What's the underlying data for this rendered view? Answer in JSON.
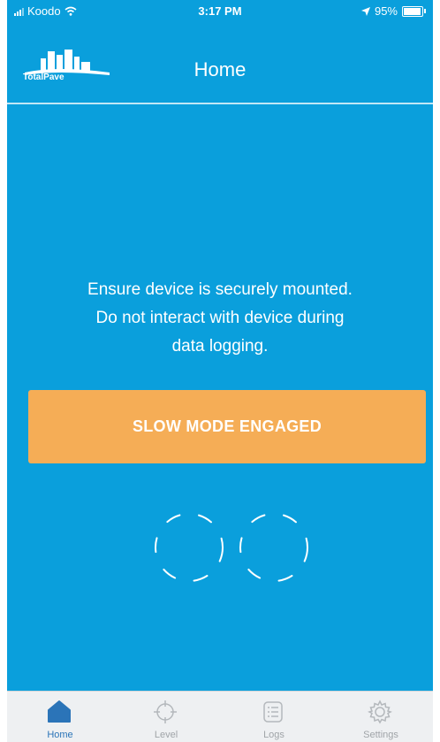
{
  "status_bar": {
    "carrier": "Koodo",
    "time": "3:17 PM",
    "battery": "95%",
    "battery_level": 0.95
  },
  "header": {
    "logo_text": "TotalPave",
    "title": "Home"
  },
  "message": {
    "line1": "Ensure device is securely mounted.",
    "line2": "Do not interact with device during",
    "line3": "data logging."
  },
  "mode_button": {
    "label": "SLOW MODE ENGAGED"
  },
  "loader": {
    "icon": "infinity-dashed-loader-icon"
  },
  "tab_bar": {
    "active": "Home",
    "tabs": [
      {
        "label": "Home",
        "icon": "home-icon"
      },
      {
        "label": "Level",
        "icon": "crosshair-icon"
      },
      {
        "label": "Logs",
        "icon": "list-icon"
      },
      {
        "label": "Settings",
        "icon": "gear-icon"
      }
    ]
  },
  "colors": {
    "background": "#0a9fdc",
    "button": "#f5ad56",
    "active_tab": "#2b74b8",
    "inactive_tab": "#a0a4a8"
  }
}
